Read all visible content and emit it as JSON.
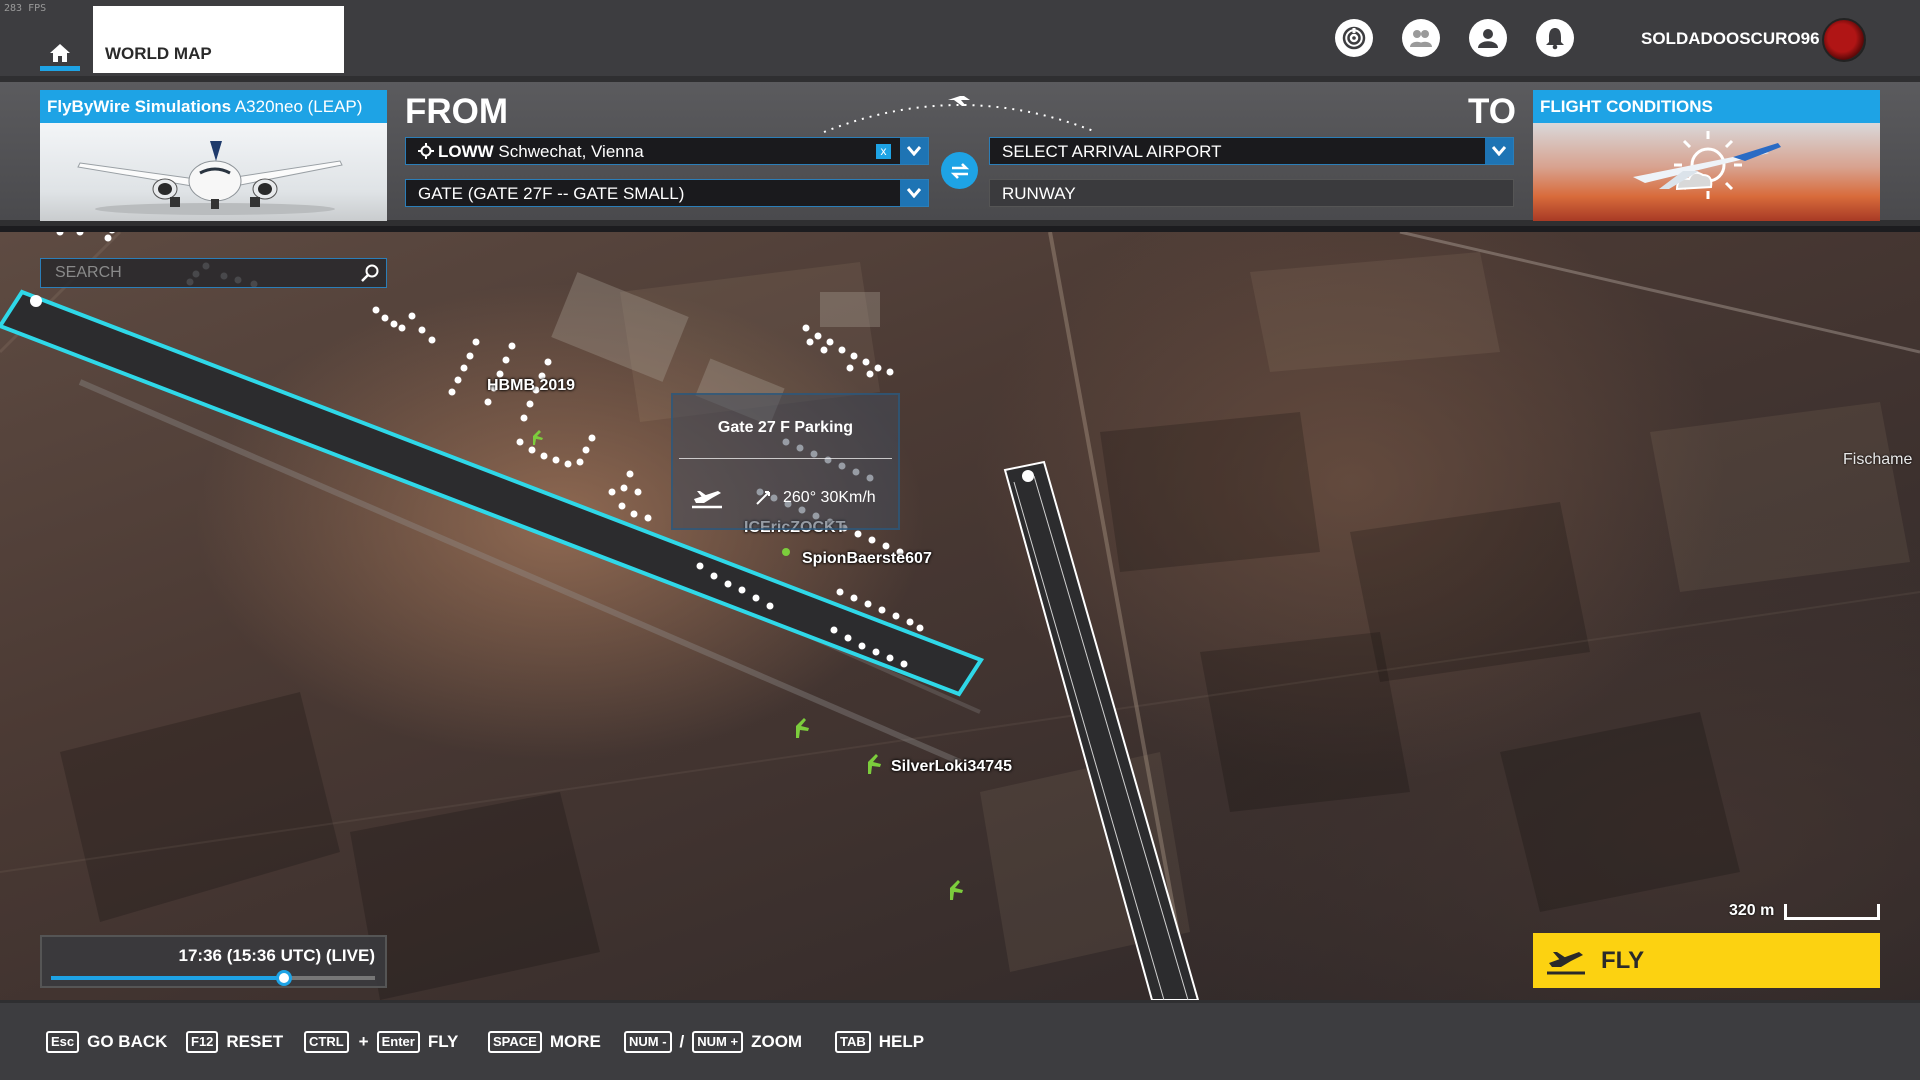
{
  "fps": "283 FPS",
  "nav": {
    "home_icon": "home-icon",
    "world_map_tab": "WORLD MAP",
    "icons": [
      "activity-icon",
      "multiplayer-icon",
      "profile-icon",
      "notifications-icon"
    ],
    "username": "SOLDADOOSCURO96"
  },
  "aircraft": {
    "brand": "FlyByWire Simulations",
    "model": " A320neo (LEAP)"
  },
  "from": {
    "label": "FROM",
    "airport_code": "LOWW",
    "airport_name": " Schwechat, Vienna",
    "clear_symbol": "x",
    "gate": "GATE (GATE 27F -- GATE SMALL)"
  },
  "to": {
    "label": "TO",
    "airport_placeholder": "SELECT ARRIVAL AIRPORT",
    "runway_placeholder": "RUNWAY"
  },
  "conditions": {
    "label": "FLIGHT CONDITIONS"
  },
  "map": {
    "search_placeholder": "SEARCH",
    "labels": {
      "hbmb": "HBMB 2019",
      "icer": "ICEricZOCKT",
      "spion": "SpionBaerste607",
      "silver": "SilverLoki34745",
      "fischamend": "Fischame"
    },
    "popup": {
      "title": "Gate 27 F Parking",
      "wind": "260° 30Km/h"
    },
    "time": {
      "text": "17:36 (15:36 UTC) (LIVE)",
      "progress": 0.72
    },
    "scale": "320 m",
    "fly_label": "FLY"
  },
  "colors": {
    "accent": "#1ea3e5",
    "fly_button": "#fcd211",
    "runway_highlight": "#2fd8e8"
  },
  "hints": [
    {
      "keys": [
        "Esc"
      ],
      "label": "GO BACK"
    },
    {
      "keys": [
        "F12"
      ],
      "label": "RESET"
    },
    {
      "keys": [
        "CTRL",
        "Enter"
      ],
      "joiner": "+",
      "label": "FLY"
    },
    {
      "keys": [
        "SPACE"
      ],
      "label": "MORE"
    },
    {
      "keys": [
        "NUM -",
        "NUM +"
      ],
      "joiner": "/",
      "label": "ZOOM"
    },
    {
      "keys": [
        "TAB"
      ],
      "label": "HELP"
    }
  ]
}
